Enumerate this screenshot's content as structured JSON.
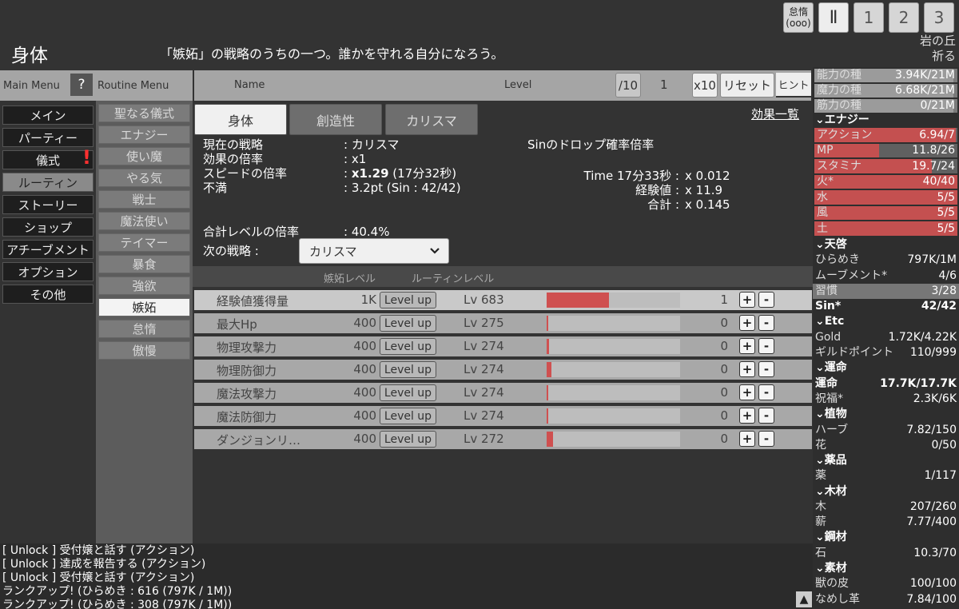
{
  "header": {
    "title": "身体",
    "description": "「嫉妬」の戦略のうちの一つ。誰かを守れる自分になろう。",
    "location_line1": "岩の丘",
    "location_line2": "祈る",
    "speed_buttons": [
      {
        "label": "怠惰",
        "sub": "(ooo)"
      },
      {
        "label": "Ⅱ"
      },
      {
        "label": "1"
      },
      {
        "label": "2"
      },
      {
        "label": "3"
      }
    ]
  },
  "main_menu": {
    "title": "Main Menu",
    "help": "?",
    "items": [
      "メイン",
      "パーティー",
      "儀式",
      "ルーティン",
      "ストーリー",
      "ショップ",
      "アチーブメント",
      "オプション",
      "その他"
    ],
    "active": "ルーティン",
    "alert": "儀式"
  },
  "routine_menu": {
    "title": "Routine Menu",
    "items": [
      "聖なる儀式",
      "エナジー",
      "使い魔",
      "やる気",
      "戦士",
      "魔法使い",
      "テイマー",
      "暴食",
      "強欲",
      "嫉妬",
      "怠惰",
      "傲慢"
    ],
    "active": "嫉妬"
  },
  "main_header": {
    "name": "Name",
    "level": "Level",
    "div10": "/10",
    "count": "1",
    "x10": "x10",
    "reset": "リセット",
    "hint": "ヒント"
  },
  "tabs": [
    "身体",
    "創造性",
    "カリスマ"
  ],
  "active_tab": "身体",
  "effects_link": "効果一覧",
  "info": {
    "current_strategy_label": "現在の戦略",
    "current_strategy_value": ": カリスマ",
    "effect_multiplier_label": "効果の倍率",
    "effect_multiplier_value": ": x1",
    "speed_multiplier_label": "スピードの倍率",
    "speed_multiplier_prefix": ": ",
    "speed_multiplier_value": "x1.29",
    "speed_multiplier_suffix": " (17分32秒)",
    "discontent_label": "不満",
    "discontent_value": ": 3.2pt (Sin : 42/42)",
    "sin_drop_title": "Sinのドロップ確率倍率",
    "time_label": "Time 17分33秒 :",
    "time_value": "x 0.012",
    "exp_label": "経験値 :",
    "exp_value": "x 11.9",
    "total_label": "合計 :",
    "total_value": "x 0.145",
    "total_level_label": "合計レベルの倍率",
    "total_level_value": ": 40.4%",
    "next_strategy_label": "次の戦略 :",
    "next_strategy_value": "カリスマ"
  },
  "table": {
    "col1": "嫉妬レベル",
    "col2": "ルーティンレベル",
    "level_up_label": "Level up",
    "plus": "+",
    "minus": "-",
    "rows": [
      {
        "name": "経験値獲得量",
        "cost": "1K",
        "lv": "Lv 683",
        "progress": 0.47,
        "value": "1"
      },
      {
        "name": "最大Hp",
        "cost": "400",
        "lv": "Lv 275",
        "progress": 0.01,
        "value": "0"
      },
      {
        "name": "物理攻撃力",
        "cost": "400",
        "lv": "Lv 274",
        "progress": 0.015,
        "value": "0"
      },
      {
        "name": "物理防御力",
        "cost": "400",
        "lv": "Lv 274",
        "progress": 0.035,
        "value": "0"
      },
      {
        "name": "魔法攻撃力",
        "cost": "400",
        "lv": "Lv 274",
        "progress": 0.01,
        "value": "0"
      },
      {
        "name": "魔法防御力",
        "cost": "400",
        "lv": "Lv 274",
        "progress": 0.01,
        "value": "0"
      },
      {
        "name": "ダンジョンリ…",
        "cost": "400",
        "lv": "Lv 272",
        "progress": 0.05,
        "value": "0"
      }
    ]
  },
  "log": [
    "[ Unlock ] 受付嬢と話す (アクション)",
    "[ Unlock ] 達成を報告する (アクション)",
    "[ Unlock ] 受付嬢と話す (アクション)",
    "ランクアップ! (ひらめき : 616 (797K / 1M))",
    "ランクアップ! (ひらめき : 308 (797K / 1M))"
  ],
  "scroll_up": "▲",
  "resources": {
    "seeds": [
      {
        "name": "能力の種",
        "value": "3.94K/21M",
        "fill": 0.97
      },
      {
        "name": "魔力の種",
        "value": "6.68K/21M",
        "fill": 0.97
      },
      {
        "name": "筋力の種",
        "value": "0/21M",
        "fill": 0.97
      }
    ],
    "energy_title": "⌄エナジー",
    "energy": [
      {
        "name": "アクション",
        "value": "6.94/7",
        "fill": 0.99
      },
      {
        "name": "MP",
        "value": "11.8/26",
        "fill": 0.45
      },
      {
        "name": "スタミナ",
        "value": "19.7/24",
        "fill": 0.82
      },
      {
        "name": "火*",
        "value": "40/40",
        "fill": 1
      },
      {
        "name": "水",
        "value": "5/5",
        "fill": 1
      },
      {
        "name": "風",
        "value": "5/5",
        "fill": 1
      },
      {
        "name": "土",
        "value": "5/5",
        "fill": 1
      }
    ],
    "groups": [
      {
        "title": "⌄天啓",
        "rows": [
          {
            "name": "ひらめき",
            "value": "797K/1M"
          },
          {
            "name": "ムーブメント*",
            "value": "4/6"
          },
          {
            "name": "習慣",
            "value": "3/28",
            "habit": true
          },
          {
            "name": "Sin*",
            "value": "42/42",
            "bold": true
          }
        ]
      },
      {
        "title": "⌄Etc",
        "rows": [
          {
            "name": "Gold",
            "value": "1.72K/4.22K"
          },
          {
            "name": "ギルドポイント",
            "value": "110/999"
          }
        ]
      },
      {
        "title": "⌄運命",
        "rows": [
          {
            "name": "運命",
            "value": "17.7K/17.7K",
            "bold": true
          },
          {
            "name": "祝福*",
            "value": "2.3K/6K"
          }
        ]
      },
      {
        "title": "⌄植物",
        "rows": [
          {
            "name": "ハーブ",
            "value": "7.82/150"
          },
          {
            "name": "花",
            "value": "0/50"
          }
        ]
      },
      {
        "title": "⌄薬品",
        "rows": [
          {
            "name": "薬",
            "value": "1/117"
          }
        ]
      },
      {
        "title": "⌄木材",
        "rows": [
          {
            "name": "木",
            "value": "207/260"
          },
          {
            "name": "薪",
            "value": "7.77/400"
          }
        ]
      },
      {
        "title": "⌄鋼材",
        "rows": [
          {
            "name": "石",
            "value": "10.3/70"
          }
        ]
      },
      {
        "title": "⌄素材",
        "rows": [
          {
            "name": "獣の皮",
            "value": "100/100"
          },
          {
            "name": "なめし革",
            "value": "7.84/100"
          }
        ]
      }
    ]
  }
}
